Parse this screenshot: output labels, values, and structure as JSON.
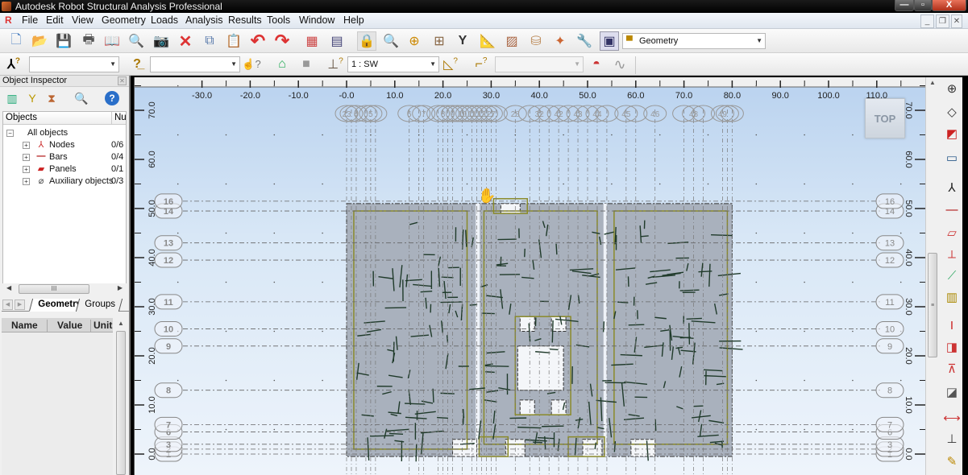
{
  "window": {
    "title": "Autodesk Robot Structural Analysis Professional",
    "controls": {
      "minimize": "—",
      "maximize": "▫",
      "close": "X"
    }
  },
  "menu": {
    "items": [
      "File",
      "Edit",
      "View",
      "Geometry",
      "Loads",
      "Analysis",
      "Results",
      "Tools",
      "Window",
      "Help"
    ],
    "mdi_controls": {
      "minimize": "_",
      "restore": "❐",
      "close": "✕"
    }
  },
  "toolbar1": {
    "buttons": [
      {
        "name": "new-icon",
        "glyph": "🗋"
      },
      {
        "name": "open-icon",
        "glyph": "📂"
      },
      {
        "name": "save-icon",
        "glyph": "💾"
      },
      {
        "name": "print-icon",
        "glyph": "🖶"
      },
      {
        "name": "print-preview-icon",
        "glyph": "📖"
      },
      {
        "name": "preview-zoom-icon",
        "glyph": "🔍"
      },
      {
        "name": "screen-capture-icon",
        "glyph": "📷"
      },
      {
        "name": "delete-icon",
        "glyph": "✕"
      },
      {
        "name": "copy-icon",
        "glyph": "⧉"
      },
      {
        "name": "paste-icon",
        "glyph": "📋"
      },
      {
        "name": "undo-icon",
        "glyph": "↶"
      },
      {
        "name": "redo-icon",
        "glyph": "↷"
      },
      {
        "name": "calculator-icon",
        "glyph": "▦"
      },
      {
        "name": "tables-icon",
        "glyph": "▤"
      },
      {
        "name": "lock-icon",
        "glyph": "🔒"
      },
      {
        "name": "zoom-window-icon",
        "glyph": "🔍"
      },
      {
        "name": "zoom-all-icon",
        "glyph": "⊕"
      },
      {
        "name": "view-split-icon",
        "glyph": "⊞"
      },
      {
        "name": "structure-model-icon",
        "glyph": "Y"
      },
      {
        "name": "section-definition-icon",
        "glyph": "📐"
      },
      {
        "name": "materials-icon",
        "glyph": "▨"
      },
      {
        "name": "job-preferences-icon",
        "glyph": "⛁"
      },
      {
        "name": "preferences-icon",
        "glyph": "✦"
      },
      {
        "name": "tools-wrench-icon",
        "glyph": "🔧"
      },
      {
        "name": "layout-selector-icon",
        "glyph": "▣"
      }
    ],
    "layout_select": {
      "value": "Geometry",
      "icon": "geometry-layout-icon"
    }
  },
  "toolbar2": {
    "node_selection": {
      "icon": "node-selection-icon",
      "value": ""
    },
    "bar_selection": {
      "icon": "bar-selection-icon",
      "value": ""
    },
    "selection_filter_icon": "selection-filter-icon",
    "view_icon": "view-3d-icon",
    "panels_icon": "panels-icon",
    "case_selection": {
      "icon": "case-selection-icon",
      "value": "1 : SW"
    },
    "mode_icon": "modal-selection-icon",
    "combination_icon": "combination-selection-icon",
    "mode_select": {
      "value": ""
    },
    "load_display_icon": "load-display-icon",
    "deformation_icon": "deformation-icon"
  },
  "inspector": {
    "title": "Object Inspector",
    "tools": [
      "filter-columns-icon",
      "filter-icon",
      "filter-clear-icon",
      "find-icon",
      "help-icon"
    ],
    "columns": [
      "Objects",
      "Nu"
    ],
    "root": "All objects",
    "items": [
      {
        "label": "Nodes",
        "count": "0/6",
        "icon": "nodes-icon"
      },
      {
        "label": "Bars",
        "count": "0/4",
        "icon": "bars-icon"
      },
      {
        "label": "Panels",
        "count": "0/1",
        "icon": "panels-icon"
      },
      {
        "label": "Auxiliary objects",
        "count": "0/3",
        "icon": "auxiliary-objects-icon"
      }
    ],
    "tabs": [
      "Geometry",
      "Groups"
    ],
    "active_tab": "Geometry",
    "prop_columns": [
      "Name",
      "Value",
      "Unit"
    ]
  },
  "view": {
    "x_ticks": [
      "-30.0",
      "-20.0",
      "-10.0",
      "-0.0",
      "10.0",
      "20.0",
      "30.0",
      "40.0",
      "50.0",
      "60.0",
      "70.0",
      "80.0",
      "90.0",
      "100.0",
      "110.0"
    ],
    "y_ticks": [
      "0.0",
      "10.0",
      "20.0",
      "30.0",
      "40.0",
      "50.0",
      "60.0",
      "70.0"
    ],
    "y_axis_labels": [
      {
        "label": "1",
        "y": 0.0
      },
      {
        "label": "2",
        "y": 1.0
      },
      {
        "label": "3",
        "y": 2.0
      },
      {
        "label": "6",
        "y": 4.5
      },
      {
        "label": "7",
        "y": 6.0
      },
      {
        "label": "8",
        "y": 13.0
      },
      {
        "label": "9",
        "y": 22.0
      },
      {
        "label": "10",
        "y": 25.5
      },
      {
        "label": "11",
        "y": 31.0
      },
      {
        "label": "12",
        "y": 39.5
      },
      {
        "label": "13",
        "y": 43.0
      },
      {
        "label": "14",
        "y": 49.5
      },
      {
        "label": "16",
        "y": 51.5
      }
    ],
    "x_axis_labels": [
      "23",
      "4",
      "5",
      "6",
      "7",
      "8",
      "9",
      "10",
      "11",
      "12",
      "27",
      "28",
      "32",
      "42",
      "43",
      "44",
      "45",
      "46",
      "48",
      "49"
    ],
    "view_cube_label": "TOP"
  },
  "right_toolbar": [
    "structural-axis-icon",
    "geometry-outline-icon",
    "structure-type-icon",
    "sections-icon",
    "nodes-icon",
    "bars-icon",
    "panel-icon",
    "openings-icon",
    "panel-reinforcement-icon",
    "foundation-icon",
    "section-i-icon",
    "materials-icon",
    "supports-icon",
    "releases-icon",
    "load-cases-icon",
    "loads-icon",
    "load-wizard-icon"
  ]
}
